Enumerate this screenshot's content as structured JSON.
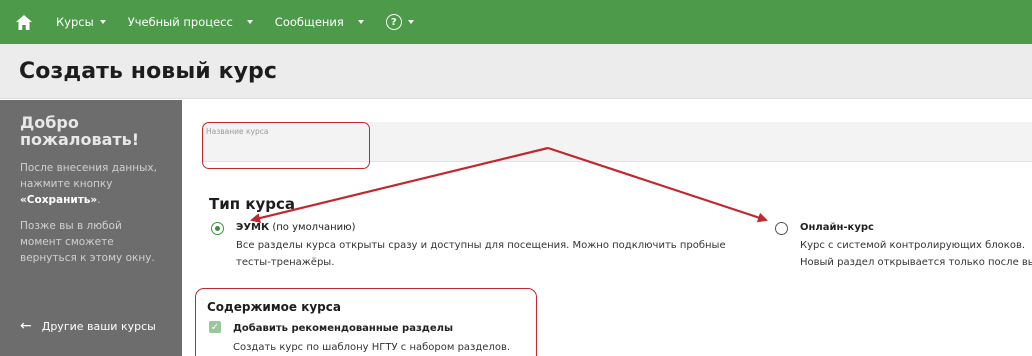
{
  "nav": {
    "items": [
      {
        "label": "Курсы"
      },
      {
        "label": "Учебный процесс"
      },
      {
        "label": "Сообщения"
      }
    ],
    "help_symbol": "?"
  },
  "page": {
    "title": "Создать новый курс"
  },
  "sidebar": {
    "title_line1": "Добро",
    "title_line2": "пожаловать!",
    "text1_pre": "После внесения данных, нажмите кнопку ",
    "text1_bold": "«Сохранить»",
    "text1_post": ".",
    "text2": "Позже вы в любой момент сможете вернуться к этому окну.",
    "back_link": "Другие ваши курсы"
  },
  "form": {
    "name_label": "Название курса",
    "name_value": "",
    "course_type_title": "Тип курса",
    "options": [
      {
        "name": "ЭУМК",
        "suffix": " (по умолчанию)",
        "desc_line1": "Все разделы курса открыты сразу и доступны для посещения. Можно подключить пробные",
        "desc_line2": "тесты-тренажёры.",
        "selected": true
      },
      {
        "name": "Онлайн-курс",
        "suffix": "",
        "desc_line1": "Курс с системой контролирующих блоков.",
        "desc_line2": "Новый раздел открывается только после вы",
        "selected": false
      }
    ],
    "content_title": "Содержимое курса",
    "content_checkbox": {
      "label": "Добавить рекомендованные разделы",
      "desc": "Создать курс по шаблону НГТУ с набором разделов.",
      "checked": true
    }
  },
  "colors": {
    "nav_bg": "#4d9a4a",
    "sidebar_bg": "#6d6d6d",
    "annotation_red": "#c0282d",
    "radio_green": "#3d8f3a"
  }
}
